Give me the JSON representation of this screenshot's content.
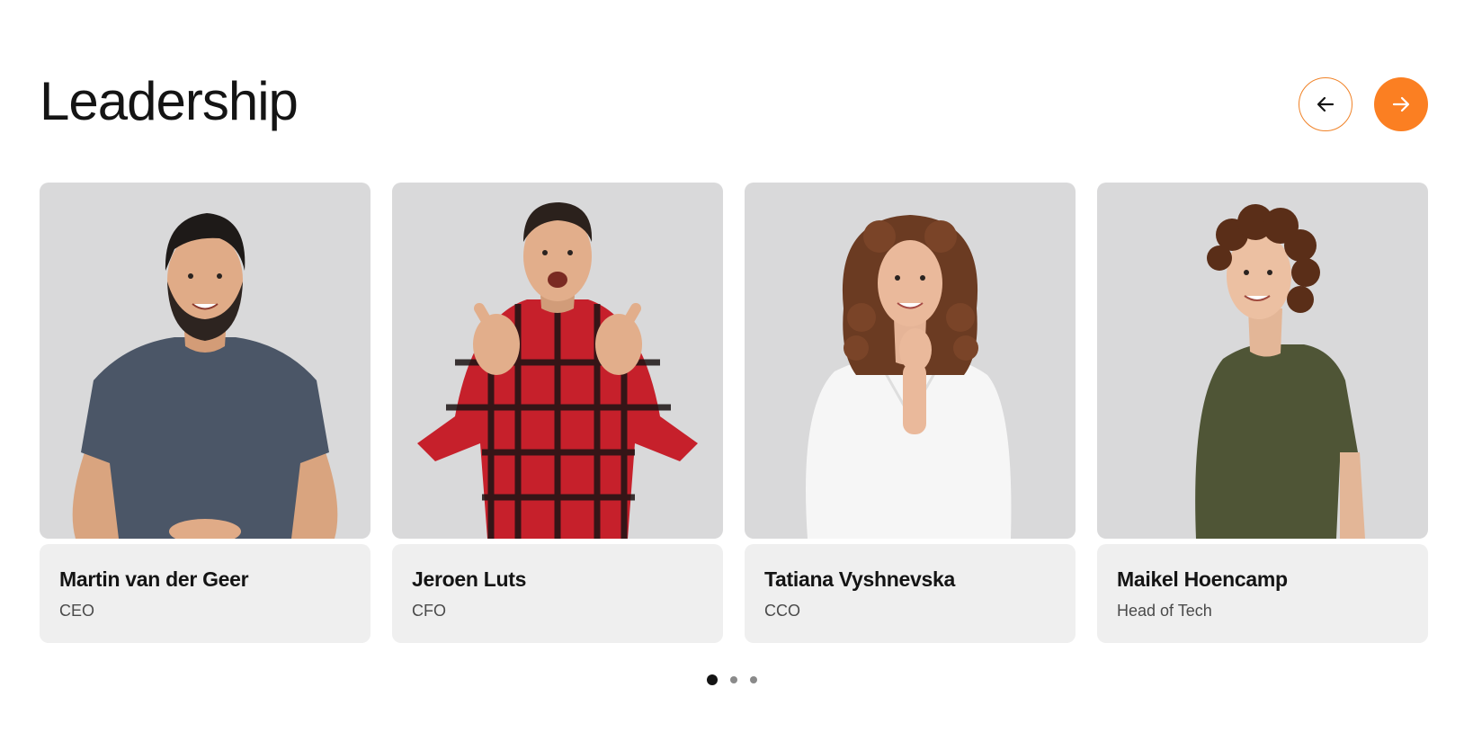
{
  "section": {
    "title": "Leadership"
  },
  "navigation": {
    "prev_icon": "arrow-left-icon",
    "next_icon": "arrow-right-icon",
    "accent_color": "#fb7f22"
  },
  "team": [
    {
      "name": "Martin van der Geer",
      "role": "CEO"
    },
    {
      "name": "Jeroen Luts",
      "role": "CFO"
    },
    {
      "name": "Tatiana Vyshnevska",
      "role": "CCO"
    },
    {
      "name": "Maikel Hoencamp",
      "role": "Head of Tech"
    }
  ],
  "pagination": {
    "pages": 3,
    "active": 1
  }
}
